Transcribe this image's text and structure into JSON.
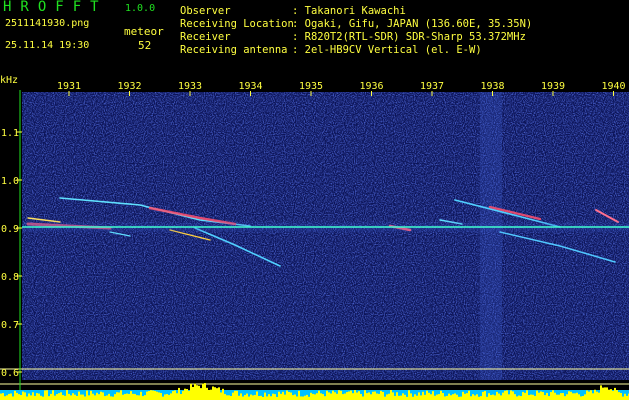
{
  "app": {
    "title": "HROFFT",
    "version": "1.0.0"
  },
  "file": {
    "name": "2511141930.png",
    "timestamp": "25.11.14 19:30"
  },
  "detection": {
    "label": "meteor",
    "count": "52"
  },
  "info": [
    {
      "label": "Observer",
      "value": ": Takanori Kawachi"
    },
    {
      "label": "Receiving Location",
      "value": ": Ogaki, Gifu, JAPAN (136.60E, 35.35N)"
    },
    {
      "label": "Receiver",
      "value": ": R820T2(RTL-SDR) SDR-Sharp 53.372MHz"
    },
    {
      "label": "Receiving antenna",
      "value": ": 2el-HB9CV Vertical (el. E-W)"
    }
  ],
  "axis": {
    "y_unit": "kHz",
    "x_ticks": [
      "1931",
      "1932",
      "1933",
      "1934",
      "1935",
      "1936",
      "1937",
      "1938",
      "1939",
      "1940"
    ],
    "y_ticks": [
      "1.1",
      "1.0",
      "0.9",
      "0.8",
      "0.7",
      "0.6"
    ],
    "y_values": [
      1.1,
      1.0,
      0.9,
      0.8,
      0.7,
      0.6
    ]
  },
  "colors": {
    "background": "#000000",
    "spectrogram": "#101a6a",
    "text_yellow": "#ffff40",
    "text_green": "#20e020",
    "carrier": "#40ffd0",
    "level_bar": "#ffff00",
    "level_base": "#00c0ff"
  }
}
